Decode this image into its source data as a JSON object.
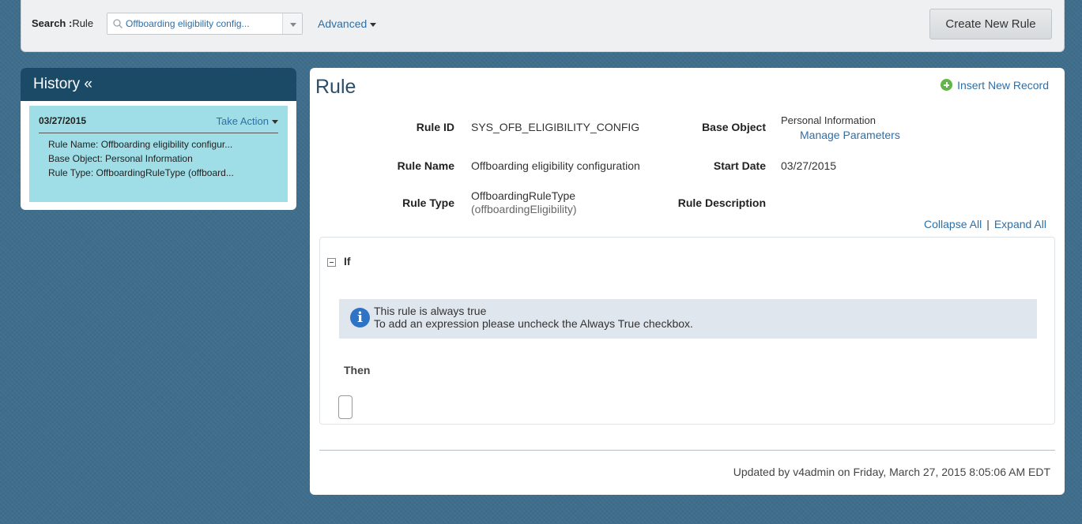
{
  "search": {
    "label_bold": "Search :",
    "label_type": "Rule",
    "value": "Offboarding eligibility config..."
  },
  "advanced_label": "Advanced",
  "create_button": "Create New Rule",
  "history": {
    "title": "History «",
    "card": {
      "date": "03/27/2015",
      "action": "Take Action",
      "rows": [
        "Rule Name: Offboarding eligibility configur...",
        "Base Object: Personal Information",
        "Rule Type: OffboardingRuleType (offboard..."
      ]
    }
  },
  "rule": {
    "title": "Rule",
    "insert_link": "Insert New Record",
    "fields": {
      "rule_id_label": "Rule ID",
      "rule_id_value": "SYS_OFB_ELIGIBILITY_CONFIG",
      "base_object_label": "Base Object",
      "base_object_value": "Personal Information",
      "manage_parameters": "Manage Parameters",
      "rule_name_label": "Rule Name",
      "rule_name_value": "Offboarding eligibility configuration",
      "start_date_label": "Start Date",
      "start_date_value": "03/27/2015",
      "rule_type_label": "Rule Type",
      "rule_type_value": "OffboardingRuleType",
      "rule_type_sub": "(offboardingEligibility)",
      "rule_description_label": "Rule Description"
    },
    "collapse_all": "Collapse All",
    "expand_all": "Expand All",
    "if_label": "If",
    "info_line1": "This rule is always true",
    "info_line2": "To add an expression please uncheck the Always True checkbox.",
    "then_label": "Then",
    "updated": "Updated by v4admin on Friday, March 27, 2015 8:05:06 AM EDT"
  }
}
